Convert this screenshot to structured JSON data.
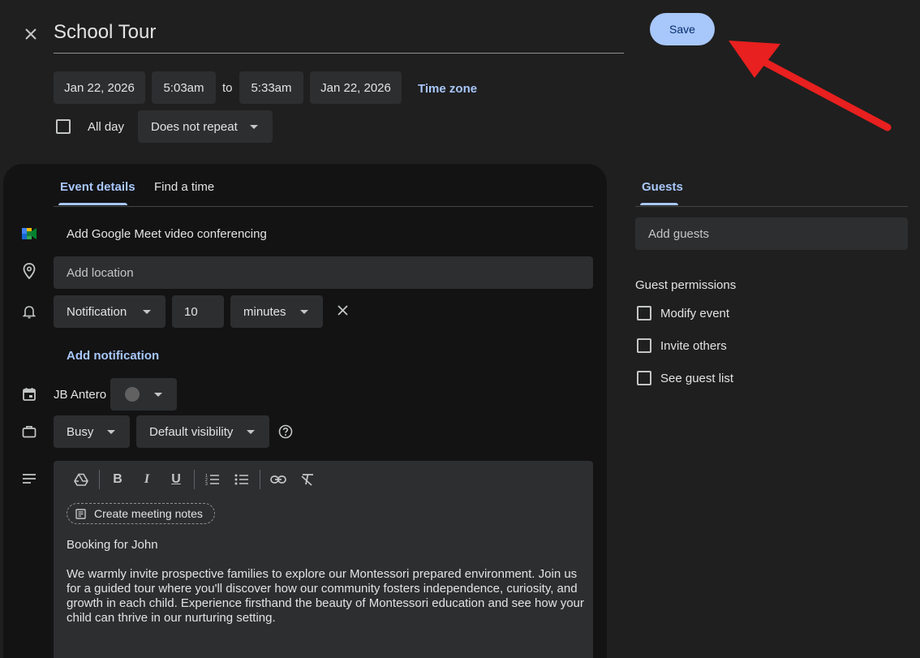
{
  "header": {
    "title": "School Tour",
    "save_label": "Save"
  },
  "datetime": {
    "start_date": "Jan 22, 2026",
    "start_time": "5:03am",
    "to_label": "to",
    "end_time": "5:33am",
    "end_date": "Jan 22, 2026",
    "timezone_label": "Time zone",
    "allday_label": "All day",
    "repeat_label": "Does not repeat"
  },
  "tabs": {
    "event_details": "Event details",
    "find_time": "Find a time",
    "guests": "Guests"
  },
  "details": {
    "meet_label": "Add Google Meet video conferencing",
    "location_placeholder": "Add location",
    "notification_type": "Notification",
    "notification_value": "10",
    "notification_unit": "minutes",
    "add_notification": "Add notification",
    "calendar_owner": "JB Antero",
    "busy_label": "Busy",
    "visibility_label": "Default visibility",
    "create_notes": "Create meeting notes",
    "description_line1": "Booking for John",
    "description_body": "We warmly invite prospective families to explore our Montessori prepared environment. Join us for a guided tour where you'll discover how our community fosters independence, curiosity, and growth in each child. Experience firsthand the beauty of Montessori education and see how your child can thrive in our nurturing setting."
  },
  "guests": {
    "add_placeholder": "Add guests",
    "permissions_title": "Guest permissions",
    "modify_event": "Modify event",
    "invite_others": "Invite others",
    "see_guest_list": "See guest list"
  },
  "colors": {
    "accent": "#a8c7fa",
    "save_bg": "#a8c7fa",
    "arrow": "#e8201f"
  }
}
